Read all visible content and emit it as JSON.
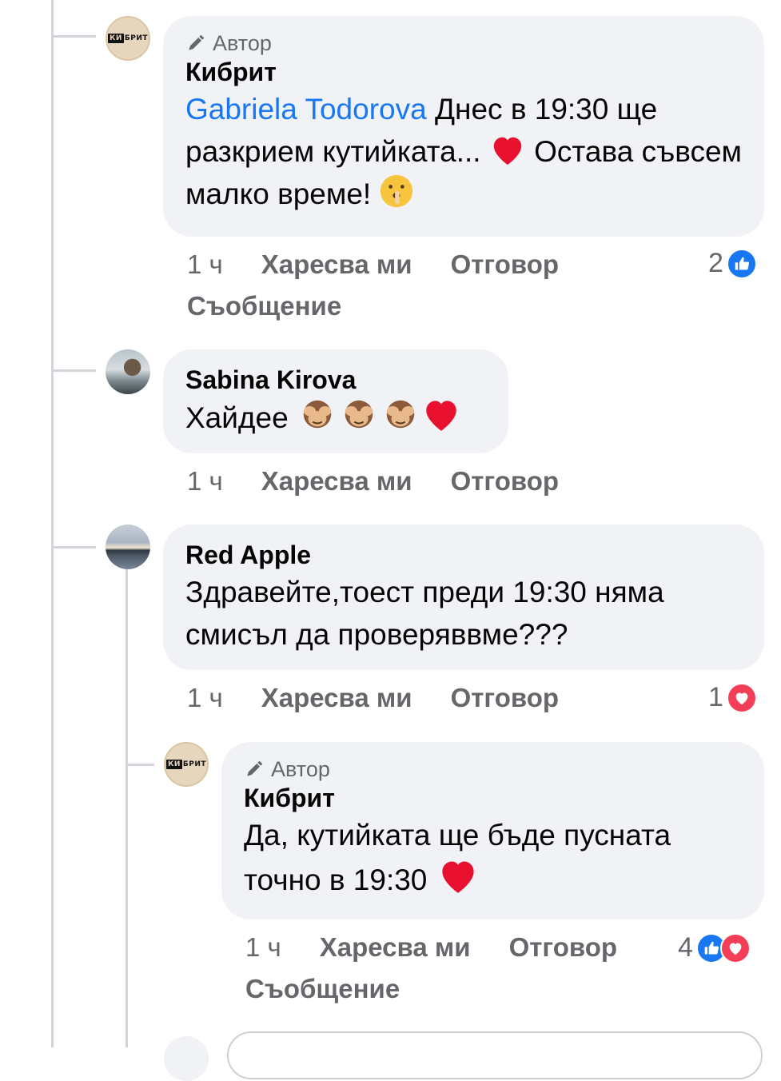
{
  "comments": [
    {
      "author_badge": "Автор",
      "name": "Кибрит",
      "mention": "Gabriela Todorova",
      "text_part1": " Днес в 19:30 ще разкрием кутийката... ",
      "text_part2": " Остава съвсем малко време! ",
      "time": "1 ч",
      "like": "Харесва ми",
      "reply": "Отговор",
      "message": "Съобщение",
      "reaction_count": "2",
      "reaction_types": [
        "like"
      ],
      "avatar_logo": "КИБРИТ",
      "emojis": [
        "red-heart-emoji",
        "shushing-face-emoji"
      ]
    },
    {
      "name": "Sabina Kirova",
      "text": "Хайдее ",
      "time": "1 ч",
      "like": "Харесва ми",
      "reply": "Отговор",
      "emojis": [
        "see-no-evil-monkey-emoji",
        "see-no-evil-monkey-emoji",
        "see-no-evil-monkey-emoji",
        "red-heart-emoji"
      ]
    },
    {
      "name": "Red Apple",
      "text": "Здравейте,тоест преди 19:30 няма смисъл да проверяввме???",
      "time": "1 ч",
      "like": "Харесва ми",
      "reply": "Отговор",
      "reaction_count": "1",
      "reaction_types": [
        "love"
      ]
    },
    {
      "author_badge": "Автор",
      "name": "Кибрит",
      "text": "Да, кутийката ще бъде пусната точно в 19:30 ",
      "time": "1 ч",
      "like": "Харесва ми",
      "reply": "Отговор",
      "message": "Съобщение",
      "reaction_count": "4",
      "reaction_types": [
        "like",
        "love"
      ],
      "avatar_logo": "КИБРИТ",
      "emojis": [
        "red-heart-emoji"
      ]
    }
  ],
  "colors": {
    "bubble_bg": "#f0f2f5",
    "mention": "#1877f2",
    "meta_text": "#65676b",
    "like_blue": "#1877f2",
    "love_red": "#f33e58",
    "thread_line": "#d3d5da"
  }
}
